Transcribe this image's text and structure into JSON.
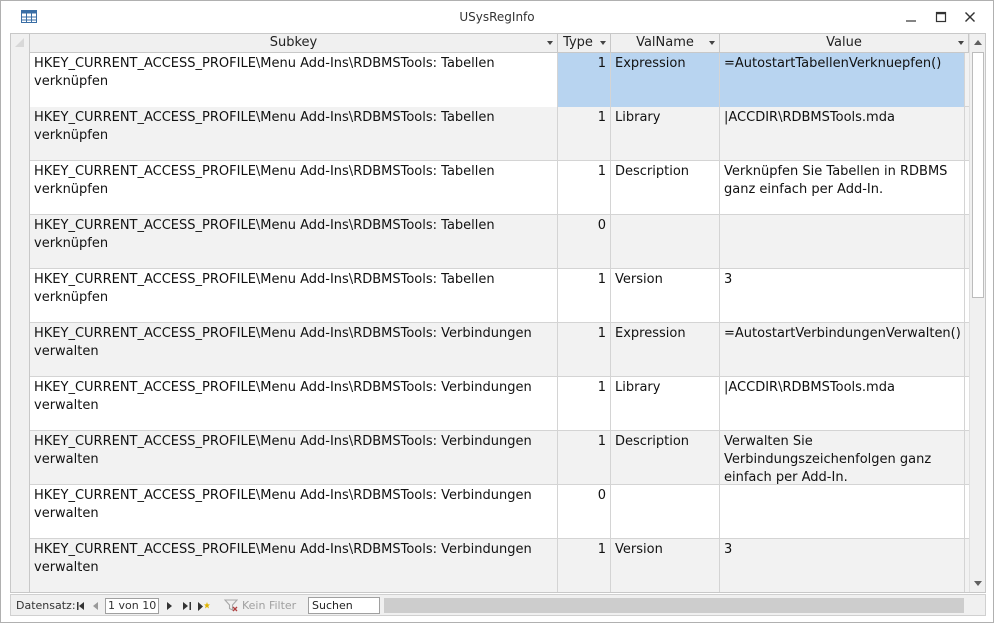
{
  "window": {
    "title": "USysRegInfo"
  },
  "columns": {
    "subkey": "Subkey",
    "type": "Type",
    "valname": "ValName",
    "value": "Value"
  },
  "rows": [
    {
      "subkey": "HKEY_CURRENT_ACCESS_PROFILE\\Menu Add-Ins\\RDBMSTools: Tabellen verknüpfen",
      "type": "1",
      "valname": "Expression",
      "value": "=AutostartTabellenVerknuepfen()"
    },
    {
      "subkey": "HKEY_CURRENT_ACCESS_PROFILE\\Menu Add-Ins\\RDBMSTools: Tabellen verknüpfen",
      "type": "1",
      "valname": "Library",
      "value": "|ACCDIR\\RDBMSTools.mda"
    },
    {
      "subkey": "HKEY_CURRENT_ACCESS_PROFILE\\Menu Add-Ins\\RDBMSTools: Tabellen verknüpfen",
      "type": "1",
      "valname": "Description",
      "value": "Verknüpfen Sie Tabellen in RDBMS ganz einfach per Add-In."
    },
    {
      "subkey": "HKEY_CURRENT_ACCESS_PROFILE\\Menu Add-Ins\\RDBMSTools: Tabellen verknüpfen",
      "type": "0",
      "valname": "",
      "value": ""
    },
    {
      "subkey": "HKEY_CURRENT_ACCESS_PROFILE\\Menu Add-Ins\\RDBMSTools: Tabellen verknüpfen",
      "type": "1",
      "valname": "Version",
      "value": "3"
    },
    {
      "subkey": "HKEY_CURRENT_ACCESS_PROFILE\\Menu Add-Ins\\RDBMSTools: Verbindungen verwalten",
      "type": "1",
      "valname": "Expression",
      "value": "=AutostartVerbindungenVerwalten()"
    },
    {
      "subkey": "HKEY_CURRENT_ACCESS_PROFILE\\Menu Add-Ins\\RDBMSTools: Verbindungen verwalten",
      "type": "1",
      "valname": "Library",
      "value": "|ACCDIR\\RDBMSTools.mda"
    },
    {
      "subkey": "HKEY_CURRENT_ACCESS_PROFILE\\Menu Add-Ins\\RDBMSTools: Verbindungen verwalten",
      "type": "1",
      "valname": "Description",
      "value": "Verwalten Sie Verbindungszeichenfolgen ganz einfach per Add-In."
    },
    {
      "subkey": "HKEY_CURRENT_ACCESS_PROFILE\\Menu Add-Ins\\RDBMSTools: Verbindungen verwalten",
      "type": "0",
      "valname": "",
      "value": ""
    },
    {
      "subkey": "HKEY_CURRENT_ACCESS_PROFILE\\Menu Add-Ins\\RDBMSTools: Verbindungen verwalten",
      "type": "1",
      "valname": "Version",
      "value": "3"
    }
  ],
  "statusbar": {
    "record_label": "Datensatz:",
    "record_position": "1 von 10",
    "filter_label": "Kein Filter",
    "search_label": "Suchen"
  },
  "icons": {
    "app": "datasheet-table-icon",
    "first": "first-record-icon",
    "prev": "previous-record-icon",
    "next": "next-record-icon",
    "last": "last-record-icon",
    "new": "new-record-icon",
    "filter": "filter-icon"
  },
  "colors": {
    "selected_cell": "#b8d4f0",
    "alt_row": "#f2f2f2"
  }
}
